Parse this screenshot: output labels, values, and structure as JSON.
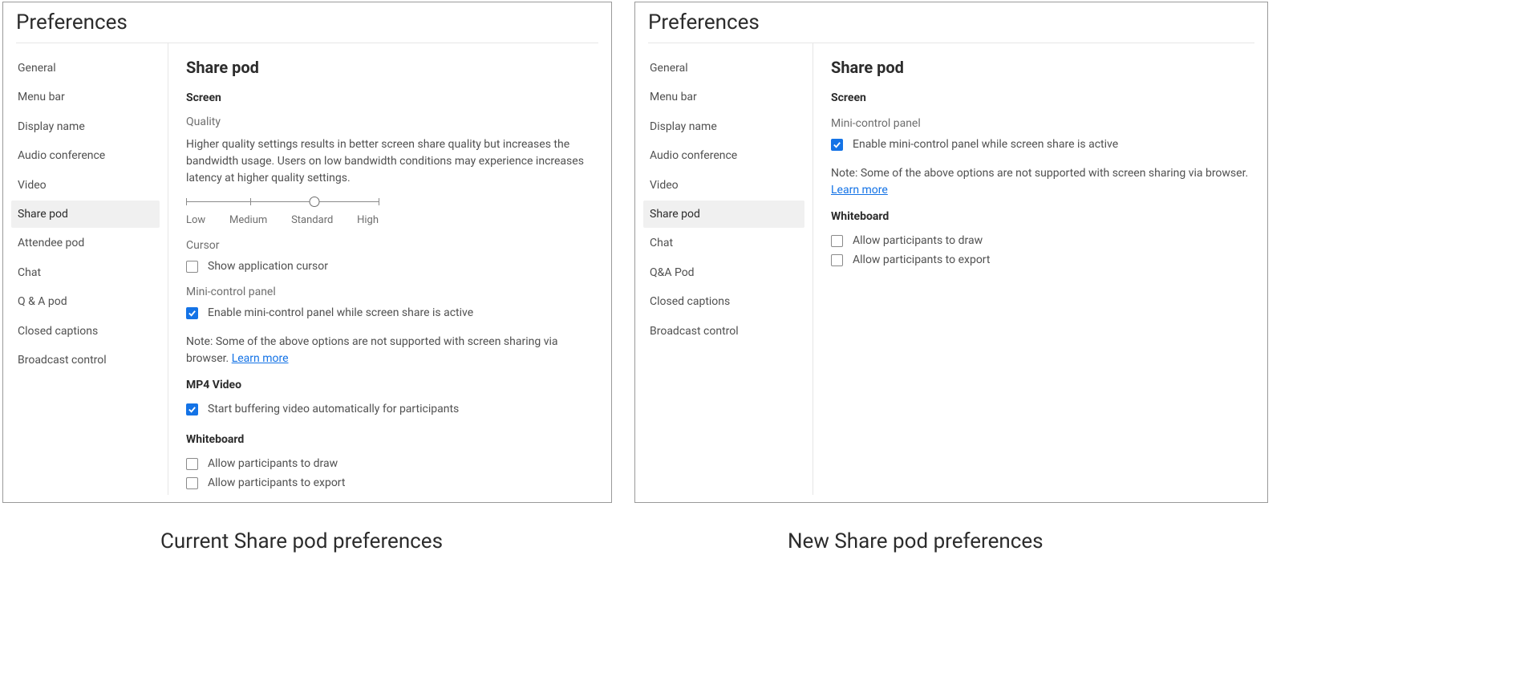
{
  "captions": {
    "left": "Current Share pod preferences",
    "right": "New Share pod preferences"
  },
  "leftPanel": {
    "title": "Preferences",
    "sidebar": [
      "General",
      "Menu bar",
      "Display name",
      "Audio conference",
      "Video",
      "Share pod",
      "Attendee pod",
      "Chat",
      "Q & A pod",
      "Closed captions",
      "Broadcast control"
    ],
    "selectedIndex": 5,
    "heading": "Share pod",
    "screen": {
      "label": "Screen",
      "quality": {
        "label": "Quality",
        "desc": "Higher quality settings results in better screen share quality but increases the bandwidth usage. Users on low bandwidth conditions may experience increases latency at higher quality settings.",
        "labels": [
          "Low",
          "Medium",
          "Standard",
          "High"
        ],
        "valueIndex": 2
      },
      "cursor": {
        "label": "Cursor",
        "option": "Show application cursor",
        "checked": false
      },
      "miniControl": {
        "label": "Mini-control panel",
        "option": "Enable mini-control panel while screen share is active",
        "checked": true
      },
      "notePrefix": "Note: Some of the above options are not supported with screen sharing via browser. ",
      "learnMore": "Learn more"
    },
    "mp4": {
      "label": "MP4 Video",
      "option": "Start buffering video automatically for participants",
      "checked": true
    },
    "whiteboard": {
      "label": "Whiteboard",
      "draw": {
        "option": "Allow participants to draw",
        "checked": false
      },
      "export": {
        "option": "Allow participants to export",
        "checked": false
      }
    }
  },
  "rightPanel": {
    "title": "Preferences",
    "sidebar": [
      "General",
      "Menu bar",
      "Display name",
      "Audio conference",
      "Video",
      "Share pod",
      "Chat",
      "Q&A Pod",
      "Closed captions",
      "Broadcast control"
    ],
    "selectedIndex": 5,
    "heading": "Share pod",
    "screen": {
      "label": "Screen",
      "miniControl": {
        "label": "Mini-control panel",
        "option": "Enable mini-control panel while screen share is active",
        "checked": true
      },
      "notePrefix": "Note: Some of the above options are not supported with screen sharing via browser. ",
      "learnMore": "Learn more"
    },
    "whiteboard": {
      "label": "Whiteboard",
      "draw": {
        "option": "Allow participants to draw",
        "checked": false
      },
      "export": {
        "option": "Allow participants to export",
        "checked": false
      }
    }
  }
}
